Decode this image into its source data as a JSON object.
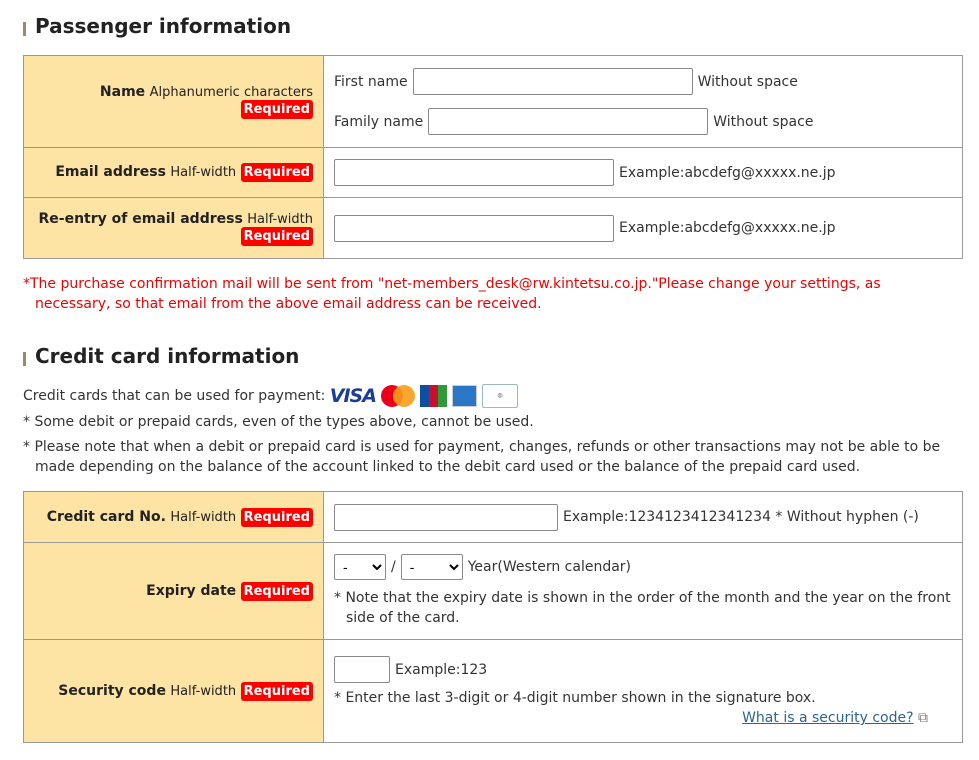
{
  "passenger": {
    "title": "Passenger information",
    "name_label": "Name",
    "name_sub": "Alphanumeric characters",
    "required": "Required",
    "first_name": "First name",
    "family_name": "Family name",
    "without_space": "Without space",
    "first_name_value": "",
    "family_name_value": "",
    "email_label": "Email address",
    "half_width": "Half-width",
    "email_example": "Example:abcdefg@xxxxx.ne.jp",
    "email_value": "",
    "reentry_label": "Re-entry of email address",
    "reentry_value": "",
    "note": "*The purchase confirmation mail will be sent from \"net-members_desk@rw.kintetsu.co.jp.\"Please change your settings, as necessary, so that email from the above email address can be received."
  },
  "credit": {
    "title": "Credit card information",
    "cards_label": "Credit cards that can be used for payment:",
    "cards": [
      "visa",
      "mastercard",
      "jcb",
      "american-express",
      "diners-club"
    ],
    "note1": "* Some debit or prepaid cards, even of the types above, cannot be used.",
    "note2": "* Please note that when a debit or prepaid card is used for payment, changes, refunds or other transactions may not be able to be made depending on the balance of the account linked to the debit card used or the balance of the prepaid card used.",
    "card_no_label": "Credit card No.",
    "card_no_example": "Example:1234123412341234 * Without hyphen (-)",
    "card_no_value": "",
    "expiry_label": "Expiry date",
    "month_value": "-",
    "year_value": "-",
    "slash": "/",
    "year_hint": "Year(Western calendar)",
    "expiry_note": "* Note that the expiry date is shown in the order of the month and the year on the front side of the card.",
    "security_label": "Security code",
    "security_example": "Example:123",
    "security_value": "",
    "security_note": "* Enter the last 3-digit or 4-digit number shown in the signature box.",
    "security_link": "What is a security code?"
  },
  "colors": {
    "label_bg": "#fde3a4",
    "required": "#ff0000",
    "note": "#ee0000",
    "link": "#2a6496"
  }
}
